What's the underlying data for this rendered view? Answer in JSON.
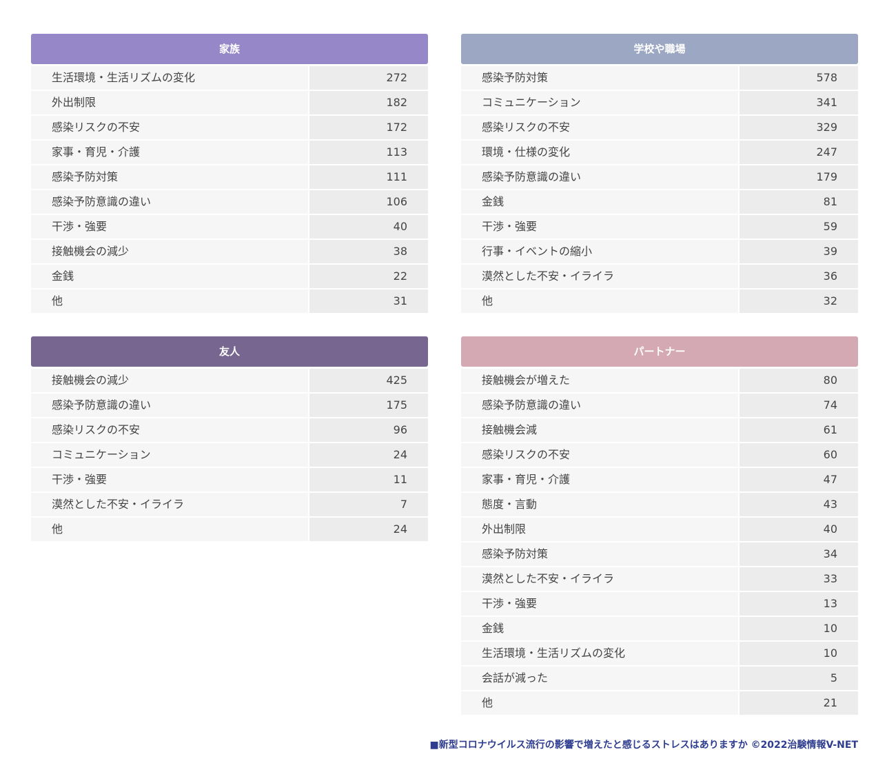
{
  "colors": {
    "family": "#9587c8",
    "school": "#9ca8c3",
    "friend": "#77668f",
    "partner": "#d4a9b3",
    "footer": "#2e3d8f"
  },
  "chart_data": [
    {
      "type": "table",
      "title": "家族",
      "categories": [
        "生活環境・生活リズムの変化",
        "外出制限",
        "感染リスクの不安",
        "家事・育児・介護",
        "感染予防対策",
        "感染予防意識の違い",
        "干渉・強要",
        "接触機会の減少",
        "金銭",
        "他"
      ],
      "values": [
        272,
        182,
        172,
        113,
        111,
        106,
        40,
        38,
        22,
        31
      ]
    },
    {
      "type": "table",
      "title": "学校や職場",
      "categories": [
        "感染予防対策",
        "コミュニケーション",
        "感染リスクの不安",
        "環境・仕様の変化",
        "感染予防意識の違い",
        "金銭",
        "干渉・強要",
        "行事・イベントの縮小",
        "漠然とした不安・イライラ",
        "他"
      ],
      "values": [
        578,
        341,
        329,
        247,
        179,
        81,
        59,
        39,
        36,
        32
      ]
    },
    {
      "type": "table",
      "title": "友人",
      "categories": [
        "接触機会の減少",
        "感染予防意識の違い",
        "感染リスクの不安",
        "コミュニケーション",
        "干渉・強要",
        "漠然とした不安・イライラ",
        "他"
      ],
      "values": [
        425,
        175,
        96,
        24,
        11,
        7,
        24
      ]
    },
    {
      "type": "table",
      "title": "パートナー",
      "categories": [
        "接触機会が増えた",
        "感染予防意識の違い",
        "接触機会減",
        "感染リスクの不安",
        "家事・育児・介護",
        "態度・言動",
        "外出制限",
        "感染予防対策",
        "漠然とした不安・イライラ",
        "干渉・強要",
        "金銭",
        "生活環境・生活リズムの変化",
        "会話が減った",
        "他"
      ],
      "values": [
        80,
        74,
        61,
        60,
        47,
        43,
        40,
        34,
        33,
        13,
        10,
        10,
        5,
        21
      ]
    }
  ],
  "footer": "■新型コロナウイルス流行の影響で増えたと感じるストレスはありますか ©2022治験情報V-NET"
}
